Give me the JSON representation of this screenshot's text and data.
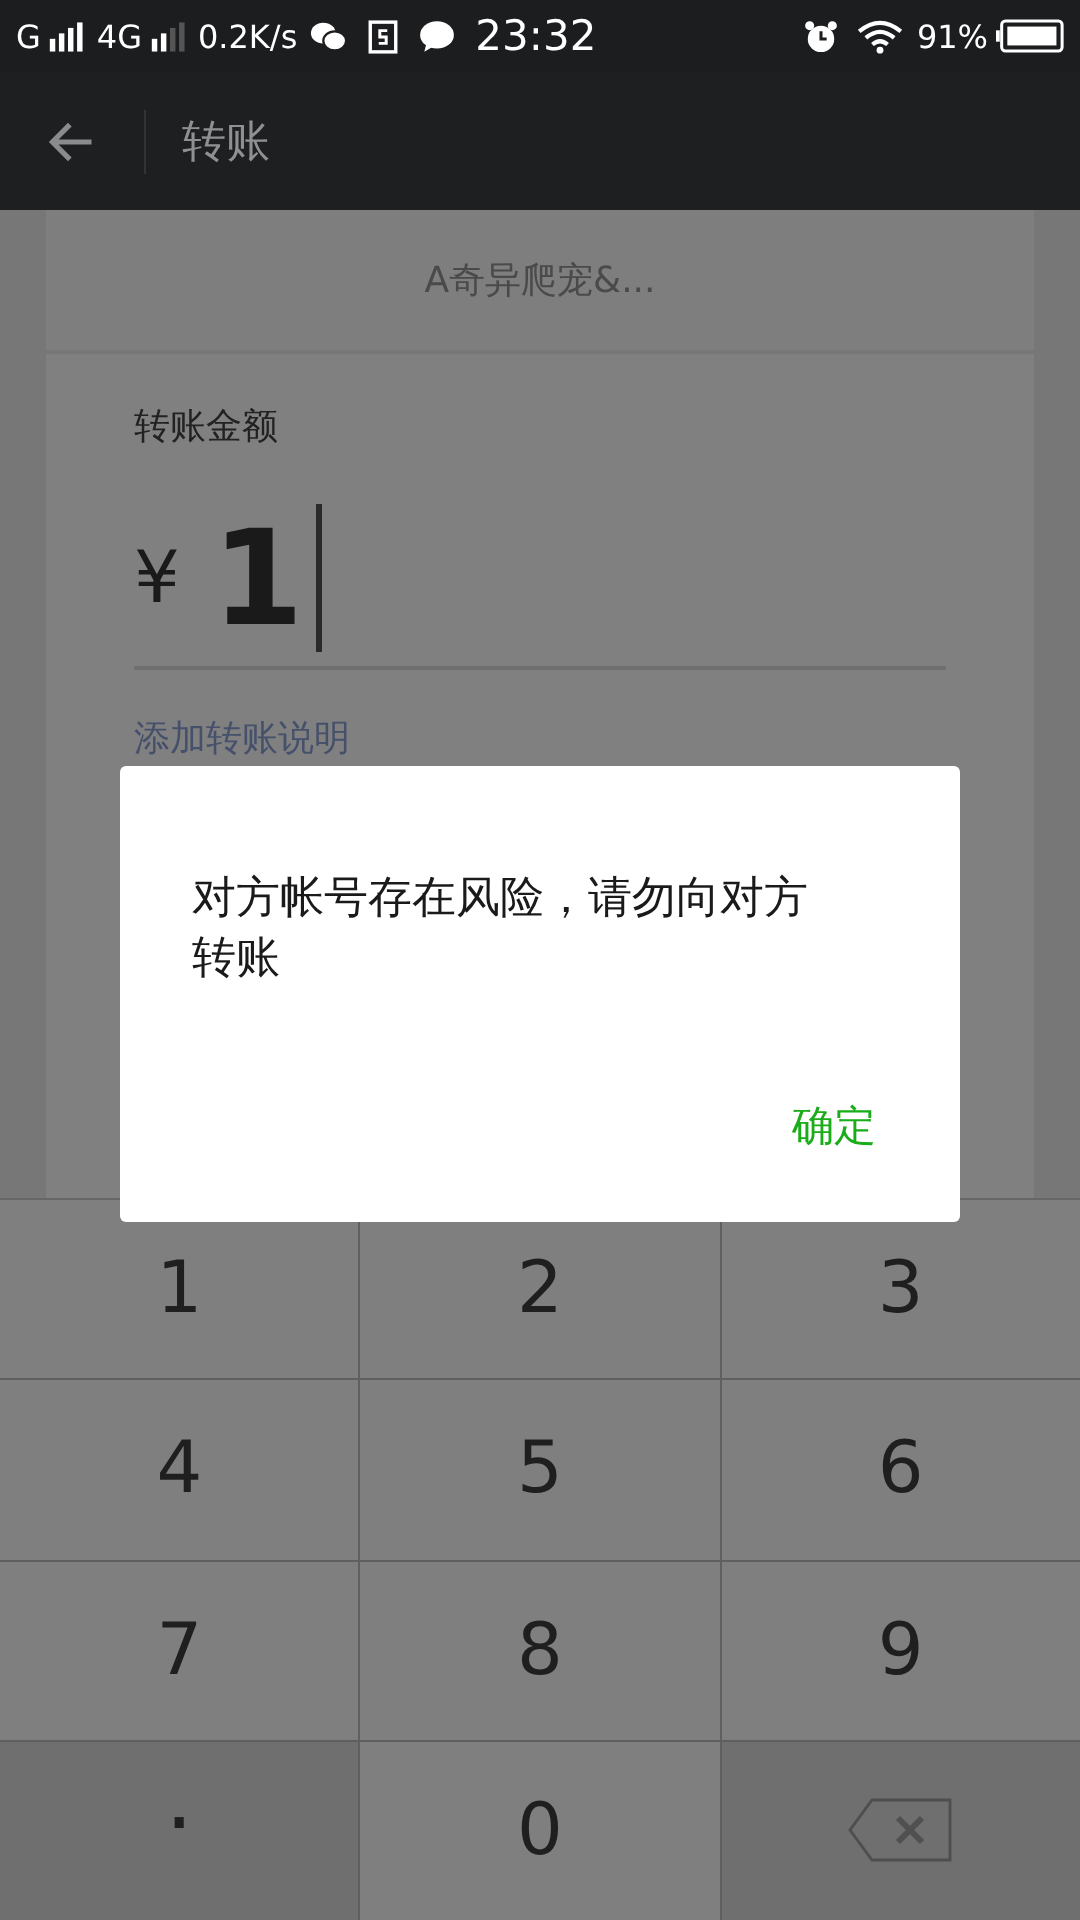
{
  "status_bar": {
    "network_1": "G",
    "network_2": "4G",
    "speed": "0.2K/s",
    "time": "23:32",
    "battery": "91%"
  },
  "header": {
    "title": "转账"
  },
  "payee": {
    "name": "A奇异爬宠&..."
  },
  "amount_card": {
    "label": "转账金额",
    "currency": "¥",
    "value": "1",
    "note_link": "添加转账说明"
  },
  "keypad": [
    {
      "kind": "digit",
      "label": "1"
    },
    {
      "kind": "digit",
      "label": "2"
    },
    {
      "kind": "digit",
      "label": "3"
    },
    {
      "kind": "digit",
      "label": "4"
    },
    {
      "kind": "digit",
      "label": "5"
    },
    {
      "kind": "digit",
      "label": "6"
    },
    {
      "kind": "digit",
      "label": "7"
    },
    {
      "kind": "digit",
      "label": "8"
    },
    {
      "kind": "digit",
      "label": "9"
    },
    {
      "kind": "dot",
      "label": "."
    },
    {
      "kind": "digit",
      "label": "0"
    },
    {
      "kind": "delete"
    }
  ],
  "dialog": {
    "message": "对方帐号存在风险，请勿向对方转账",
    "confirm": "确定"
  }
}
